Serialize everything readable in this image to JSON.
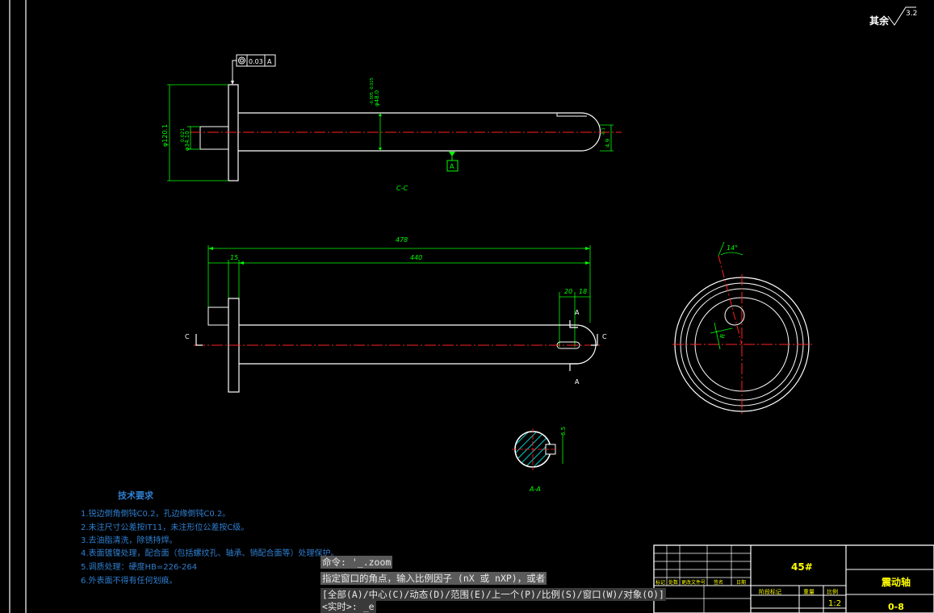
{
  "surface_symbol": {
    "label": "其余",
    "value": "3.2"
  },
  "flatness": {
    "tolerance": "0.03",
    "datum": "A"
  },
  "top_view": {
    "dim_left_big": "φ120.1",
    "dim_left_small": "φ34.10",
    "dim_left_small_tol": "0.021",
    "dim_mid": "φ48.0",
    "dim_mid_tol": "-0.005 -0.025",
    "dim_right": "4.9",
    "dim_right_tol": "-0.1",
    "datum_label": "A",
    "section_label": "C-C"
  },
  "front_view": {
    "dim_total": "478",
    "dim_flange": "15",
    "dim_shaft": "440",
    "dim_slot1": "20",
    "dim_slot2": "18",
    "cut_c": "C",
    "cut_a": "A"
  },
  "circle_view": {
    "angle": "14°",
    "radius": "R"
  },
  "section_a": {
    "dim": "6.5",
    "label": "A-A"
  },
  "tech_req": {
    "title": "技术要求",
    "items": [
      "1.锐边倒角倒钝C0.2，孔边缘倒钝C0.2。",
      "2.未注尺寸公差按IT11，未注形位公差按C级。",
      "3.去油脂清洗，除锈持焊。",
      "4.表面镀镍处理，配合面（包括螺纹孔、轴承、销配合面等）处理保护。",
      "5.调质处理：硬度HB=226-264",
      "6.外表面不得有任何划痕。"
    ]
  },
  "title_block": {
    "material": "45#",
    "part_name": "震动轴",
    "scale": "1:2",
    "drawing_no": "0-8",
    "header_cells": [
      "标记",
      "处数",
      "更改文件号",
      "签名",
      "日期"
    ],
    "stage_cells": [
      "阶段标记",
      "重量",
      "比例"
    ]
  },
  "command_line": {
    "line1": "命令: '_.zoom",
    "line2": "指定窗口的角点，输入比例因子 (nX 或 nXP)，或者",
    "line3": "[全部(A)/中心(C)/动态(D)/范围(E)/上一个(P)/比例(S)/窗口(W)/对象(O)]",
    "line4": "<实时>: _e"
  },
  "colors": {
    "background": "#000000",
    "line": "#ffffff",
    "dimension": "#00ff00",
    "centerline": "#ff0000",
    "text_note": "#2f7fd0",
    "hatch": "#00c8c8",
    "title_yellow": "#ffff00"
  }
}
